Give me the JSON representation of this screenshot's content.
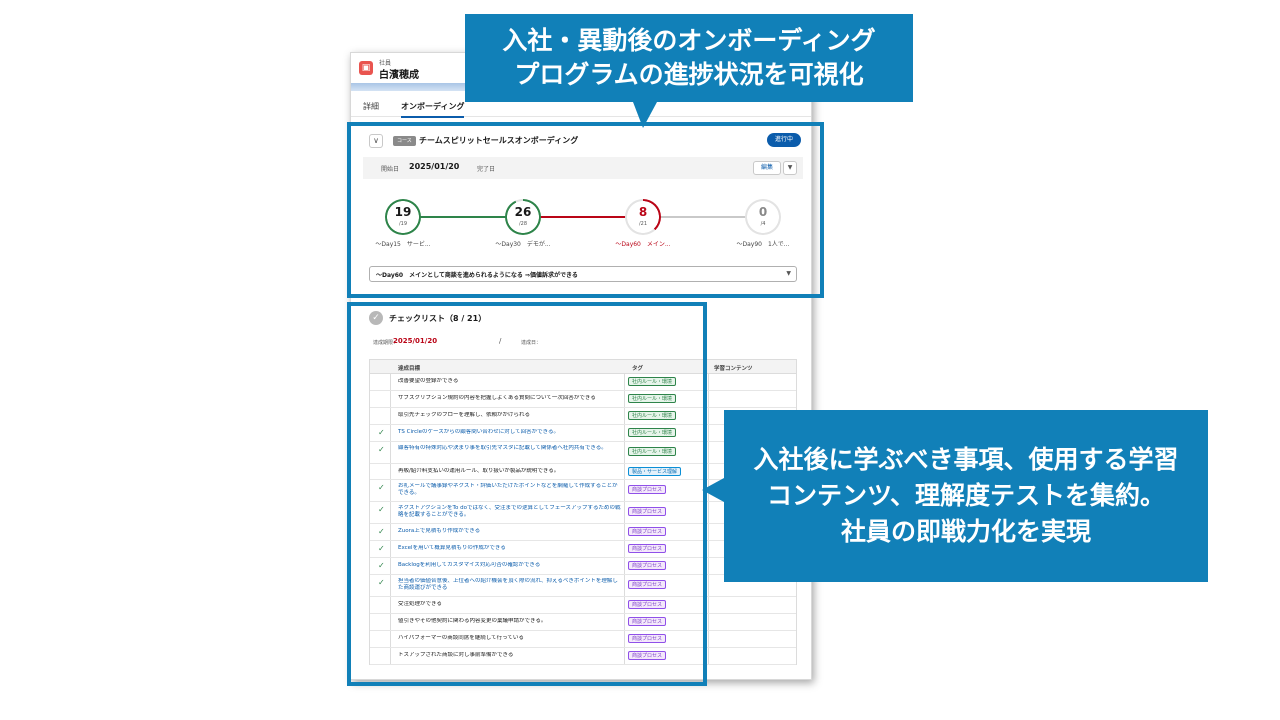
{
  "record": {
    "object_label": "社員",
    "name": "白濱穂成"
  },
  "tabs": {
    "detail": "詳細",
    "onboarding": "オンボーディング"
  },
  "course": {
    "chevron": "∨",
    "type_badge": "コース",
    "title": "チームスピリットセールスオンボーディング",
    "status": "進行中",
    "start_label": "開始日",
    "start_date": "2025/01/20",
    "end_label": "完了日",
    "edit_label": "編集",
    "edit_caret": "▼"
  },
  "milestones": [
    {
      "done": "19",
      "total": "/19",
      "label": "〜Day15　サービ..."
    },
    {
      "done": "26",
      "total": "/28",
      "label": "〜Day30　デモが..."
    },
    {
      "done": "8",
      "total": "/21",
      "label": "〜Day60　メイン..."
    },
    {
      "done": "0",
      "total": "/4",
      "label": "〜Day90　1人で..."
    }
  ],
  "milestone_progress": [
    1.0,
    0.93,
    0.38,
    0.0
  ],
  "phase_select": {
    "value": "〜Day60　メインとして商談を進められるようになる ⇒価値訴求ができる",
    "caret": "▼"
  },
  "checklist": {
    "title": "チェックリスト（8 / 21）",
    "due_label": "達成期限：",
    "due_date": "2025/01/20",
    "slash": "/",
    "done_label": "達成日：",
    "columns": {
      "goal": "達成目標",
      "tag": "タグ",
      "content": "学習コンテンツ"
    },
    "rows": [
      {
        "done": false,
        "goal": "改善要望の登録ができる",
        "tag": "社内ルール・環境",
        "tag_color": "green",
        "tall": false
      },
      {
        "done": false,
        "goal": "サブスクリプション規約の内容を把握しよくある質問について一次回答ができる",
        "tag": "社内ルール・環境",
        "tag_color": "green",
        "tall": false
      },
      {
        "done": false,
        "goal": "取引先チェックのフローを理解し、依頼がかけられる",
        "tag": "社内ルール・環境",
        "tag_color": "green",
        "tall": false
      },
      {
        "done": true,
        "goal": "TS Circleのケースからの顧客問い合わせに対して回答ができる。",
        "tag": "社内ルール・環境",
        "tag_color": "green",
        "tall": false
      },
      {
        "done": true,
        "goal": "顧客特有の特殊対応や決まり事を取引先マスタに記載して関係者へ社内共有できる。",
        "tag": "社内ルール・環境",
        "tag_color": "green",
        "tall": true
      },
      {
        "done": false,
        "goal": "再販/紹介料支払いの運用ルール、取り扱いが製品が説明できる。",
        "tag": "製品・サービス理解",
        "tag_color": "blue",
        "tall": false
      },
      {
        "done": true,
        "goal": "お礼メールで議事録やネクスト・評価いただけたポイントなどを網羅して作成することができる。",
        "tag": "商談プロセス",
        "tag_color": "purple",
        "tall": true
      },
      {
        "done": true,
        "goal": "ネクストアクションをTo doではなく、受注までの逆算としてフェーズアップするための戦略を記載することができる。",
        "tag": "商談プロセス",
        "tag_color": "purple",
        "tall": true
      },
      {
        "done": true,
        "goal": "Zuora上で見積もり作成ができる",
        "tag": "商談プロセス",
        "tag_color": "purple",
        "tall": false
      },
      {
        "done": true,
        "goal": "Excelを用いて概算見積もりの作成ができる",
        "tag": "商談プロセス",
        "tag_color": "purple",
        "tall": false
      },
      {
        "done": true,
        "goal": "Backlogを利用してカスタマイズ対応可否の確認ができる",
        "tag": "商談プロセス",
        "tag_color": "purple",
        "tall": false
      },
      {
        "done": true,
        "goal": "担当者の価値合意後、上位者への紹介機会を頂く際の流れ、抑えるべきポイントを理解した商談運びができる",
        "tag": "商談プロセス",
        "tag_color": "purple",
        "tall": true
      },
      {
        "done": false,
        "goal": "受注処理ができる",
        "tag": "商談プロセス",
        "tag_color": "purple",
        "tall": false
      },
      {
        "done": false,
        "goal": "値引きやその他契約に関わる内容変更の稟議申請ができる。",
        "tag": "商談プロセス",
        "tag_color": "purple",
        "tall": false
      },
      {
        "done": false,
        "goal": "ハイパフォーマーの商談同席を継続して行っている",
        "tag": "商談プロセス",
        "tag_color": "purple",
        "tall": false
      },
      {
        "done": false,
        "goal": "トスアップされた商談に対し事前準備ができる",
        "tag": "商談プロセス",
        "tag_color": "purple",
        "tall": false
      }
    ]
  },
  "callouts": {
    "top": [
      "入社・異動後のオンボーディング",
      "プログラムの進捗状況を可視化"
    ],
    "right": [
      "入社後に学ぶべき事項、使用する学習",
      "コンテンツ、理解度テストを集約。",
      "社員の即戦力化を実現"
    ]
  },
  "colors": {
    "accent": "#1180b8",
    "green": "#2e844a",
    "red": "#ba0517",
    "gray": "#c9c9c9"
  }
}
